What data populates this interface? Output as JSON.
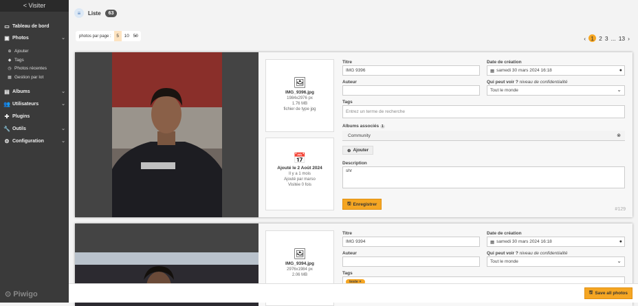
{
  "sidebar": {
    "visit": "< Visiter",
    "items": [
      {
        "label": "Tableau de bord",
        "icon": "monitor-icon"
      },
      {
        "label": "Photos",
        "icon": "image-icon"
      },
      {
        "label": "Albums",
        "icon": "album-icon"
      },
      {
        "label": "Utilisateurs",
        "icon": "users-icon"
      },
      {
        "label": "Plugins",
        "icon": "puzzle-icon"
      },
      {
        "label": "Outils",
        "icon": "wrench-icon"
      },
      {
        "label": "Configuration",
        "icon": "gear-icon"
      }
    ],
    "photos_sub": [
      "Ajouter",
      "Tags",
      "Photos récentes",
      "Gestion par lot"
    ],
    "logo": "Piwigo"
  },
  "header": {
    "title": "Liste",
    "count": "63"
  },
  "per_page": {
    "label": "photos par page :",
    "options": [
      "5",
      "10",
      "50"
    ],
    "selected": "5"
  },
  "pagination": {
    "prev": "‹",
    "pages": [
      "1",
      "2",
      "3",
      "...",
      "13"
    ],
    "current": "1",
    "next": "›"
  },
  "labels": {
    "title": "Titre",
    "date": "Date de création",
    "author": "Auteur",
    "who": "Qui peut voir ?",
    "who_hint": "niveau de confidentialité",
    "tags": "Tags",
    "albums": "Albums associés",
    "add": "Ajouter",
    "description": "Description",
    "save": "Enregistrer"
  },
  "photos": [
    {
      "filename": "IMG_9396.jpg",
      "dims": "1984x2976 px",
      "size": "1.76 MB",
      "type": "fichier de type jpg",
      "added": "Ajouté le 2 Août 2024",
      "ago": "Il y a 1 mois",
      "by": "Ajouté par marso",
      "visits": "Visitée 0 fois",
      "title": "IMG 9396",
      "date": "samedi 30 mars 2024 16:18",
      "author": "",
      "privacy": "Tout le monde",
      "tags_placeholder": "Entrez un terme de recherche",
      "albums_count": "1",
      "album": "Community",
      "description": "shr",
      "id": "#129"
    },
    {
      "filename": "IMG_9394.jpg",
      "dims": "2976x1984 px",
      "size": "2.06 MB",
      "title": "IMG 9394",
      "date": "samedi 30 mars 2024 16:18",
      "author": "",
      "privacy": "Tout le monde",
      "tag": "teste"
    }
  ],
  "footer": {
    "save_all": "Save all photos"
  },
  "colors": {
    "accent": "#f5a623",
    "sidebar": "#3a3a3a"
  }
}
